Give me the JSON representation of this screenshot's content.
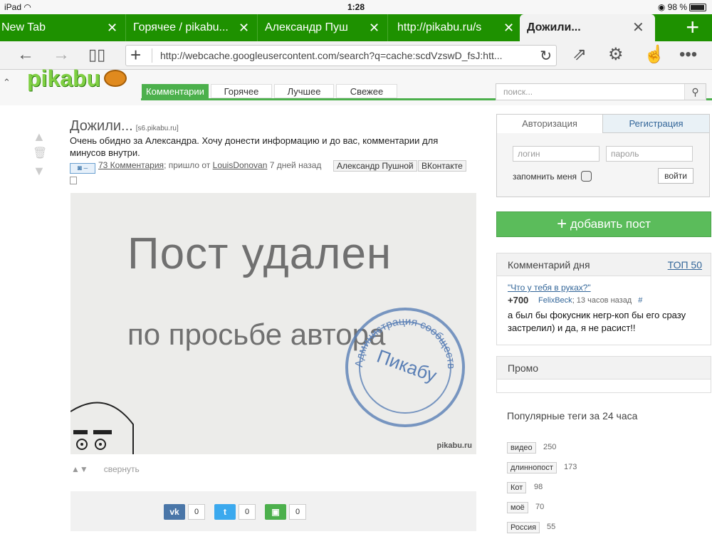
{
  "statusbar": {
    "device": "iPad",
    "time": "1:28",
    "battery": "98 %"
  },
  "tabs": [
    {
      "label": "New Tab"
    },
    {
      "label": "Горячее / pikabu..."
    },
    {
      "label": "Александр Пуш"
    },
    {
      "label": "http://pikabu.ru/s"
    },
    {
      "label": "Дожили...",
      "active": true
    }
  ],
  "toolbar": {
    "url": "http://webcache.googleusercontent.com/search?q=cache:scdVzswD_fsJ:htt..."
  },
  "site": {
    "logo": "pikabu",
    "nav": [
      "Комментарии",
      "Горячее",
      "Лучшее",
      "Свежее"
    ],
    "search_placeholder": "поиск..."
  },
  "post": {
    "title": "Дожили...",
    "source": "[s6.pikabu.ru]",
    "description": "Очень обидно за Александра. Хочу донести информацию и до вас, комментарии для минусов внутри.",
    "comments_link": "73 Комментария",
    "sent_by": "; пришло от",
    "author": "LouisDonovan",
    "ago": "7 дней назад",
    "tags": [
      "Александр Пушной",
      "ВКонтакте"
    ],
    "image_text_1": "Пост удален",
    "image_text_2": "по просьбе автора",
    "stamp_outer": "Администрация сообщества",
    "stamp_inner": "Пикабу",
    "watermark": "pikabu.ru",
    "collapse": "свернуть",
    "share": [
      {
        "net": "vk",
        "label": "vk",
        "count": "0",
        "color": "#4a76a8"
      },
      {
        "net": "twitter",
        "label": "t",
        "count": "0",
        "color": "#3ba9ee"
      },
      {
        "net": "save",
        "label": "s",
        "count": "0",
        "color": "#4cb04c"
      }
    ]
  },
  "auth": {
    "tab_login": "Авторизация",
    "tab_register": "Регистрация",
    "login_placeholder": "логин",
    "password_placeholder": "пароль",
    "remember": "запомнить меня",
    "submit": "войти"
  },
  "add_post": "добавить пост",
  "comment_of_day": {
    "header": "Комментарий дня",
    "top_link": "ТОП 50",
    "post_link": "\"Что у тебя в руках?\"",
    "score": "+700",
    "user": "FelixBeck",
    "time": "; 13 часов назад",
    "hash": "#",
    "text": "а был бы фокусник негр-коп бы его сразу застрелил) и да, я не расист!!"
  },
  "promo": {
    "header": "Промо"
  },
  "popular_tags": {
    "header": "Популярные теги за 24 часа",
    "items": [
      {
        "name": "видео",
        "count": "250"
      },
      {
        "name": "длиннопост",
        "count": "173"
      },
      {
        "name": "Кот",
        "count": "98"
      },
      {
        "name": "моё",
        "count": "70"
      },
      {
        "name": "Россия",
        "count": "55"
      }
    ]
  },
  "colors": {
    "tabbar": "#1e9100",
    "accent": "#4cb04c",
    "link": "#336699"
  }
}
